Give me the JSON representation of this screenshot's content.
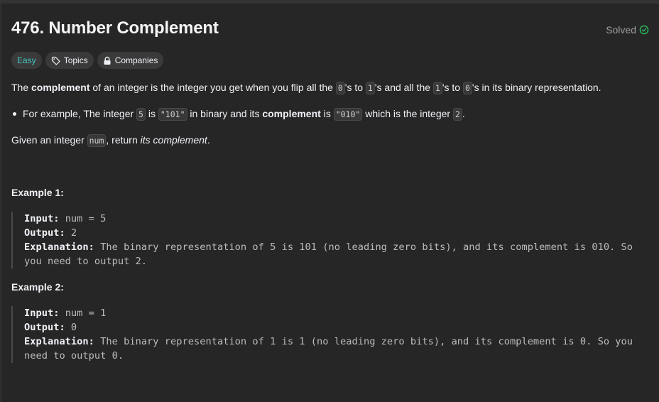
{
  "problem": {
    "title": "476. Number Complement",
    "status": "Solved",
    "status_icon": "check-circle-icon",
    "colors": {
      "background": "#262626",
      "easy": "#46c6c2",
      "solved_check": "#2cbb5d"
    }
  },
  "chips": {
    "difficulty": "Easy",
    "topics": "Topics",
    "companies": "Companies"
  },
  "description": {
    "p1_a": "The ",
    "p1_b": "complement",
    "p1_c": " of an integer is the integer you get when you flip all the ",
    "p1_code1": "0",
    "p1_d": "'s to ",
    "p1_code2": "1",
    "p1_e": "'s and all the ",
    "p1_code3": "1",
    "p1_f": "'s to ",
    "p1_code4": "0",
    "p1_g": "'s in its binary representation.",
    "b_a": "For example, The integer ",
    "b_code1": "5",
    "b_b": " is ",
    "b_code2": "\"101\"",
    "b_c": " in binary and its ",
    "b_d": "complement",
    "b_e": " is ",
    "b_code3": "\"010\"",
    "b_f": " which is the integer ",
    "b_code4": "2",
    "b_g": ".",
    "p3_a": "Given an integer ",
    "p3_code": "num",
    "p3_b": ", return ",
    "p3_c": "its complement",
    "p3_d": "."
  },
  "examples": [
    {
      "title": "Example 1:",
      "input_label": "Input:",
      "input": " num = 5",
      "output_label": "Output:",
      "output": " 2",
      "explanation_label": "Explanation:",
      "explanation": " The binary representation of 5 is 101 (no leading zero bits), and its complement is 010. So you need to output 2."
    },
    {
      "title": "Example 2:",
      "input_label": "Input:",
      "input": " num = 1",
      "output_label": "Output:",
      "output": " 0",
      "explanation_label": "Explanation:",
      "explanation": " The binary representation of 1 is 1 (no leading zero bits), and its complement is 0. So you need to output 0."
    }
  ]
}
